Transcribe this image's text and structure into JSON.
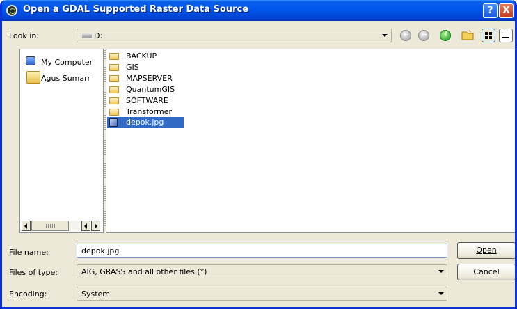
{
  "window": {
    "title": "Open a GDAL Supported Raster Data Source",
    "help_label": "?",
    "close_label": "X"
  },
  "toolbar": {
    "look_in_label": "Look in:",
    "look_in_value": "D:"
  },
  "sidebar": {
    "items": [
      {
        "label": "My Computer",
        "icon": "computer-icon"
      },
      {
        "label": "Agus Sumarr",
        "icon": "folder-icon"
      }
    ]
  },
  "files": [
    {
      "name": "BACKUP",
      "type": "folder"
    },
    {
      "name": "GIS",
      "type": "folder"
    },
    {
      "name": "MAPSERVER",
      "type": "folder"
    },
    {
      "name": "QuantumGIS",
      "type": "folder"
    },
    {
      "name": "SOFTWARE",
      "type": "folder"
    },
    {
      "name": "Transformer",
      "type": "folder"
    },
    {
      "name": "depok.jpg",
      "type": "image",
      "selected": true
    }
  ],
  "form": {
    "file_name_label": "File name:",
    "file_name_value": "depok.jpg",
    "files_of_type_label": "Files of type:",
    "files_of_type_value": "AIG, GRASS and all other files (*)",
    "encoding_label": "Encoding:",
    "encoding_value": "System"
  },
  "buttons": {
    "open": "Open",
    "cancel": "Cancel"
  },
  "colors": {
    "titlebar": "#0058ee",
    "selection": "#316ac5",
    "dialog_bg": "#ece9d8"
  }
}
